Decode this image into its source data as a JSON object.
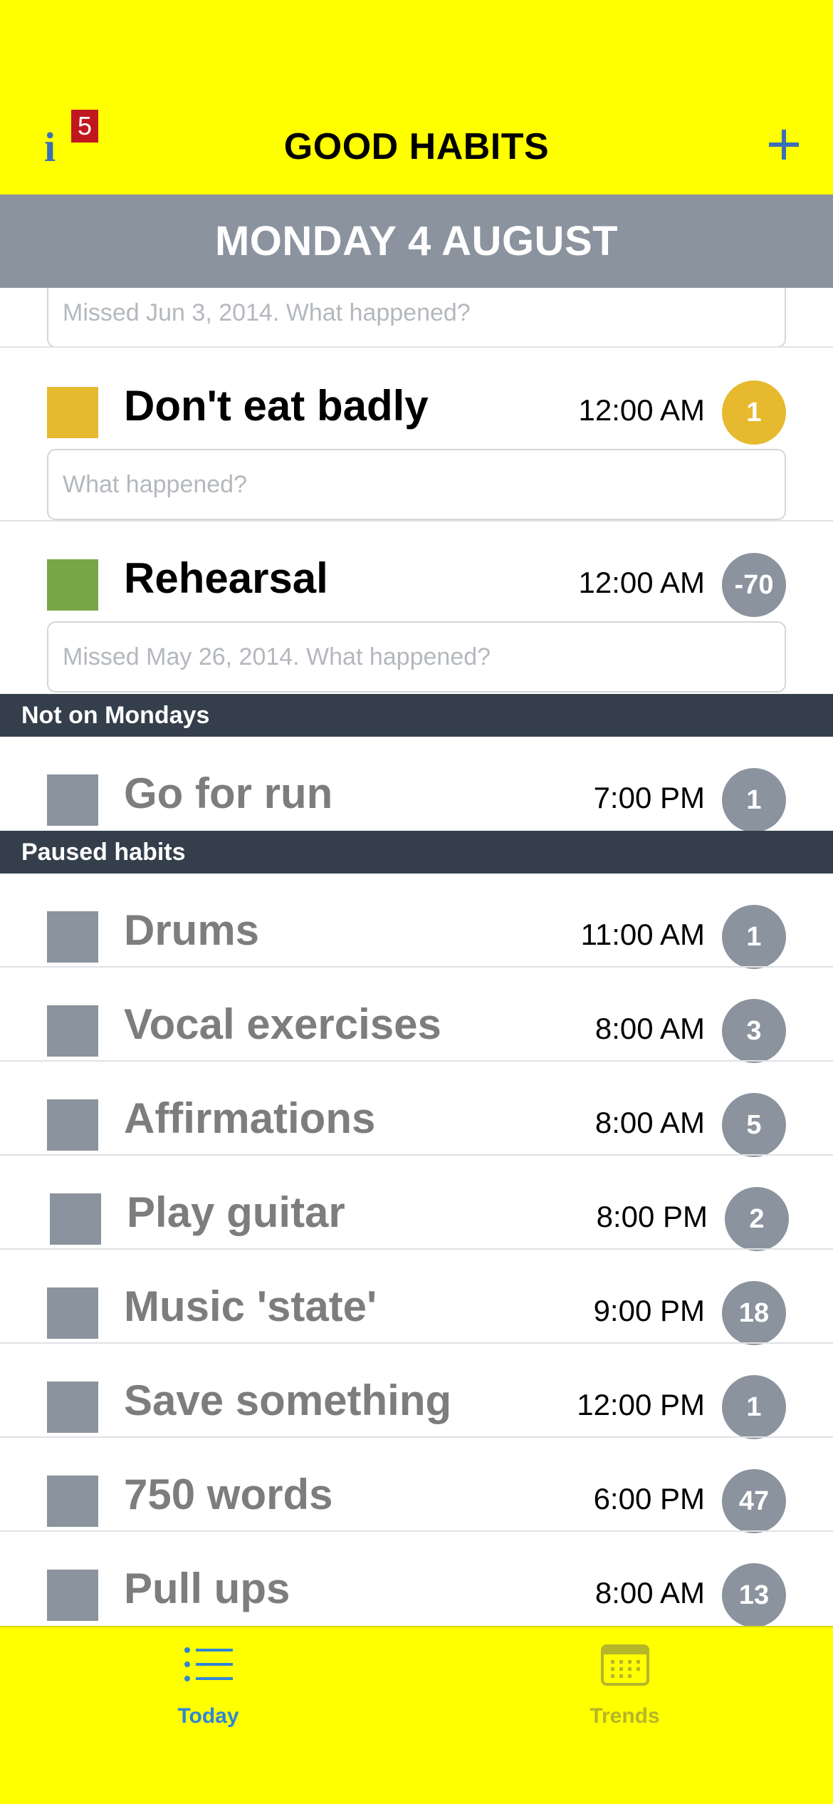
{
  "header": {
    "title": "GOOD HABITS",
    "info_icon": "i",
    "info_badge": "5",
    "add_icon": "plus-icon"
  },
  "date_bar": {
    "label": "MONDAY 4 AUGUST"
  },
  "notes": {
    "top_partial": "Missed Jun 3, 2014. What happened?",
    "dont_eat_badly": "What happened?",
    "rehearsal": "Missed May 26, 2014. What happened?"
  },
  "habits": [
    {
      "name": "Don't eat badly",
      "time": "12:00 AM",
      "count": "1",
      "box_color": "#e6b92e",
      "count_color": "#e6b92e"
    },
    {
      "name": "Rehearsal",
      "time": "12:00 AM",
      "count": "-70",
      "box_color": "#78a646",
      "count_color": "#8a939e"
    }
  ],
  "sections": {
    "not_on_mondays": "Not on Mondays",
    "paused": "Paused habits"
  },
  "not_on_mondays_habits": [
    {
      "name": "Go for run",
      "time": "7:00 PM",
      "count": "1"
    }
  ],
  "paused_habits": [
    {
      "name": "Drums",
      "time": "11:00 AM",
      "count": "1"
    },
    {
      "name": "Vocal exercises",
      "time": "8:00 AM",
      "count": "3"
    },
    {
      "name": "Affirmations",
      "time": "8:00 AM",
      "count": "5"
    },
    {
      "name": "Play guitar",
      "time": "8:00 PM",
      "count": "2"
    },
    {
      "name": "Music 'state'",
      "time": "9:00 PM",
      "count": "18"
    },
    {
      "name": "Save something",
      "time": "12:00 PM",
      "count": "1"
    },
    {
      "name": "750 words",
      "time": "6:00 PM",
      "count": "47"
    },
    {
      "name": "Pull ups",
      "time": "8:00 AM",
      "count": "13"
    }
  ],
  "muted_color": "#8a939e",
  "tabs": {
    "today": "Today",
    "trends": "Trends"
  },
  "colors": {
    "accent_yellow": "#ffff00",
    "accent_blue": "#3a6fb8",
    "tab_active": "#2f86d6"
  }
}
